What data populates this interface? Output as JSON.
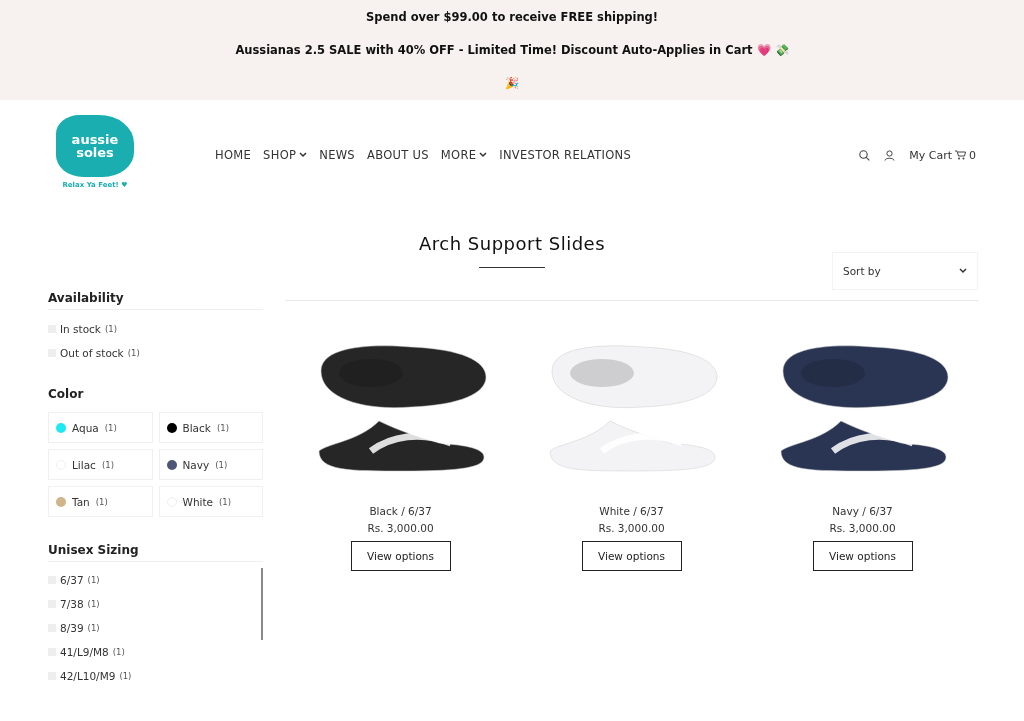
{
  "announcements": [
    "Spend over $99.00 to receive FREE shipping!",
    "Aussianas 2.5 SALE with 40% OFF - Limited Time! Discount Auto-Applies in Cart 💗 💸",
    "🎉"
  ],
  "logo": {
    "name_line_1": "aussie",
    "name_line_2": "soles",
    "tagline": "Relax Ya Feet! ♥"
  },
  "nav": [
    {
      "label": "HOME",
      "has_menu": false
    },
    {
      "label": "SHOP",
      "has_menu": true
    },
    {
      "label": "NEWS",
      "has_menu": false
    },
    {
      "label": "ABOUT US",
      "has_menu": false
    },
    {
      "label": "MORE",
      "has_menu": true
    },
    {
      "label": "INVESTOR RELATIONS",
      "has_menu": false
    }
  ],
  "cart": {
    "label": "My Cart",
    "count": "0"
  },
  "page_title": "Arch Support Slides",
  "filters": {
    "availability": {
      "title": "Availability",
      "options": [
        {
          "label": "In stock",
          "count": "(1)",
          "checked": false
        },
        {
          "label": "Out of stock",
          "count": "(1)",
          "checked": false
        }
      ]
    },
    "color": {
      "title": "Color",
      "options": [
        {
          "label": "Aqua",
          "count": "(1)",
          "color": "#1ee8f2"
        },
        {
          "label": "Black",
          "count": "(1)",
          "color": "#000000"
        },
        {
          "label": "Lilac",
          "count": "(1)",
          "color": "#ffffff"
        },
        {
          "label": "Navy",
          "count": "(1)",
          "color": "#4e5677"
        },
        {
          "label": "Tan",
          "count": "(1)",
          "color": "#d0b48a"
        },
        {
          "label": "White",
          "count": "(1)",
          "color": "#ffffff"
        }
      ]
    },
    "sizing": {
      "title": "Unisex Sizing",
      "options": [
        {
          "label": "6/37",
          "count": "(1)",
          "checked": false
        },
        {
          "label": "7/38",
          "count": "(1)",
          "checked": false
        },
        {
          "label": "8/39",
          "count": "(1)",
          "checked": false
        },
        {
          "label": "41/L9/M8",
          "count": "(1)",
          "checked": false
        },
        {
          "label": "42/L10/M9",
          "count": "(1)",
          "checked": false
        }
      ]
    }
  },
  "sort": {
    "label": "Sort by"
  },
  "products": [
    {
      "title": "Black / 6/37",
      "price": "Rs. 3,000.00",
      "button": "View options",
      "color": "#262626"
    },
    {
      "title": "White / 6/37",
      "price": "Rs. 3,000.00",
      "button": "View options",
      "color": "#f3f3f5"
    },
    {
      "title": "Navy / 6/37",
      "price": "Rs. 3,000.00",
      "button": "View options",
      "color": "#2a3553"
    }
  ]
}
